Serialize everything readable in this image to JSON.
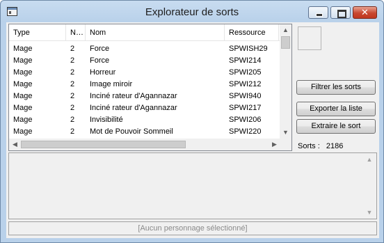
{
  "window": {
    "title": "Explorateur de sorts",
    "close_glyph": "✕"
  },
  "list": {
    "columns": [
      "Type",
      "N…",
      "Nom",
      "Ressource"
    ],
    "rows": [
      {
        "type": "Mage",
        "n": "2",
        "nom": "Force",
        "res": "SPWISH29"
      },
      {
        "type": "Mage",
        "n": "2",
        "nom": "Force",
        "res": "SPWI214"
      },
      {
        "type": "Mage",
        "n": "2",
        "nom": "Horreur",
        "res": "SPWI205"
      },
      {
        "type": "Mage",
        "n": "2",
        "nom": "Image miroir",
        "res": "SPWI212"
      },
      {
        "type": "Mage",
        "n": "2",
        "nom": "Inciné rateur d'Agannazar",
        "res": "SPWI940"
      },
      {
        "type": "Mage",
        "n": "2",
        "nom": "Inciné rateur d'Agannazar",
        "res": "SPWI217"
      },
      {
        "type": "Mage",
        "n": "2",
        "nom": "Invisibilité",
        "res": "SPWI206"
      },
      {
        "type": "Mage",
        "n": "2",
        "nom": "Mot de Pouvoir Sommeil",
        "res": "SPWI220"
      }
    ]
  },
  "buttons": {
    "filter": "Filtrer les sorts",
    "export": "Exporter la liste",
    "extract": "Extraire le sort"
  },
  "stats": {
    "label": "Sorts :",
    "count": "2186"
  },
  "status": {
    "text": "[Aucun personnage sélectionné]"
  },
  "icons": [
    "window-icon",
    "minimize-icon",
    "maximize-icon",
    "close-icon",
    "scroll-up-icon",
    "scroll-down-icon",
    "scroll-left-icon",
    "scroll-right-icon"
  ]
}
